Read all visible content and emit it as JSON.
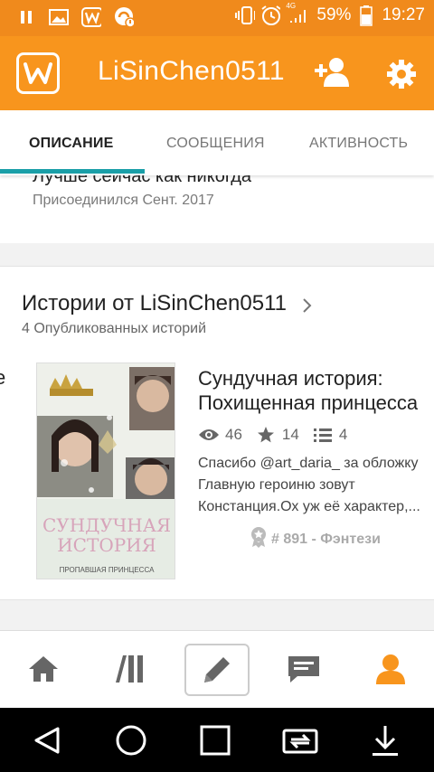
{
  "status_bar": {
    "battery_percent": "59%",
    "time": "19:27",
    "network_label": "4G",
    "icons": [
      "pause-icon",
      "image-icon",
      "wattpad-notif-icon",
      "notification-icon",
      "vibrate-icon",
      "alarm-icon",
      "signal-icon",
      "battery-icon"
    ]
  },
  "app_bar": {
    "title": "LiSinChen0511",
    "logo_letter": "w"
  },
  "tabs": [
    {
      "label": "ОПИСАНИЕ",
      "active": true
    },
    {
      "label": "СООБЩЕНИЯ",
      "active": false
    },
    {
      "label": "АКТИВНОСТЬ",
      "active": false
    }
  ],
  "about": {
    "text": "Лучше сейчас как никогда",
    "joined": "Присоединился Сент. 2017"
  },
  "stories": {
    "title": "Истории от LiSinChen0511",
    "count_text": "4 Опубликованных историй",
    "edge_letter": "е",
    "story": {
      "title_line1": "Сундучная история:",
      "title_line2": "Похищенная принцесса",
      "reads": "46",
      "votes": "14",
      "parts": "4",
      "description_lines": [
        "Спасибо @art_daria_  за обложку",
        "Главную героиню зовут",
        "Констанция.Ох уж её характер,..."
      ],
      "rank": "# 891 - Фэнтези",
      "cover_title_line1": "СУНДУЧНАЯ",
      "cover_title_line2": "ИСТОРИЯ",
      "cover_subtitle": "ПРОПАВШАЯ ПРИНЦЕССА"
    }
  },
  "bottom_nav": [
    "home-icon",
    "library-icon",
    "write-icon",
    "messages-icon",
    "profile-icon"
  ],
  "colors": {
    "brand_orange": "#f8951d",
    "status_orange": "#f08a1c",
    "tab_indicator": "#1a9fa8",
    "active_nav": "#f8951d"
  }
}
